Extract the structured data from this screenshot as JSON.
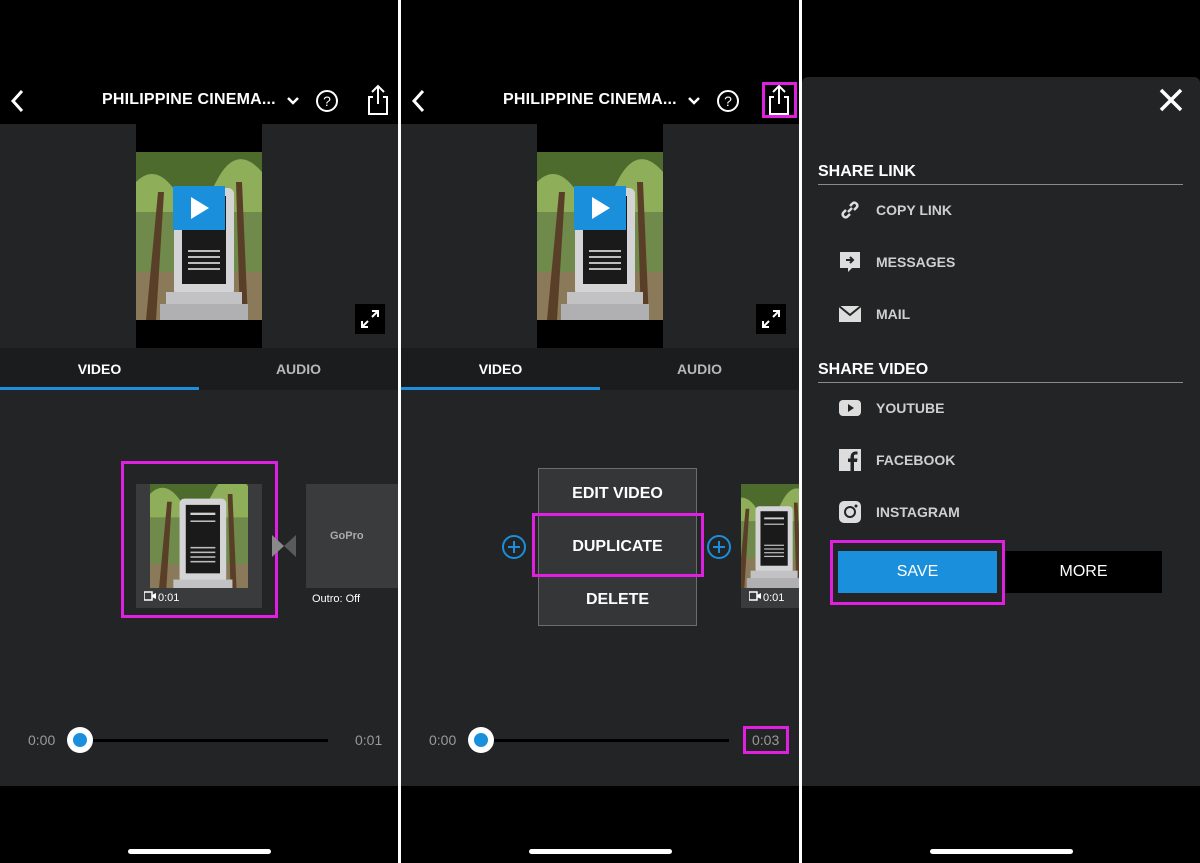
{
  "editor": {
    "title": "PHILIPPINE CINEMA...",
    "tabs": {
      "video": "VIDEO",
      "audio": "AUDIO"
    },
    "clip_duration": "0:01",
    "outro_label": "Outro: Off",
    "outro_logo": "GoPro",
    "timeline_start": "0:00",
    "timeline_end_1": "0:01",
    "timeline_end_2": "0:03",
    "timeline_progress": 0
  },
  "clip_menu": {
    "edit": "EDIT VIDEO",
    "duplicate": "DUPLICATE",
    "delete": "DELETE"
  },
  "share_sheet": {
    "share_link_heading": "SHARE LINK",
    "copy_link": "COPY LINK",
    "messages": "MESSAGES",
    "mail": "MAIL",
    "share_video_heading": "SHARE VIDEO",
    "youtube": "YOUTUBE",
    "facebook": "FACEBOOK",
    "instagram": "INSTAGRAM",
    "save": "SAVE",
    "more": "MORE"
  },
  "colors": {
    "accent": "#1a8fdc",
    "highlight": "#e020e0",
    "surface": "#232426",
    "background": "#000000"
  },
  "icons": [
    "back-arrow-icon",
    "chevron-down-icon",
    "help-icon",
    "share-icon",
    "play-icon",
    "expand-icon",
    "video-camera-icon",
    "transition-icon",
    "plus-icon",
    "close-icon",
    "link-icon",
    "messages-icon",
    "mail-icon",
    "youtube-icon",
    "facebook-icon",
    "instagram-icon"
  ]
}
